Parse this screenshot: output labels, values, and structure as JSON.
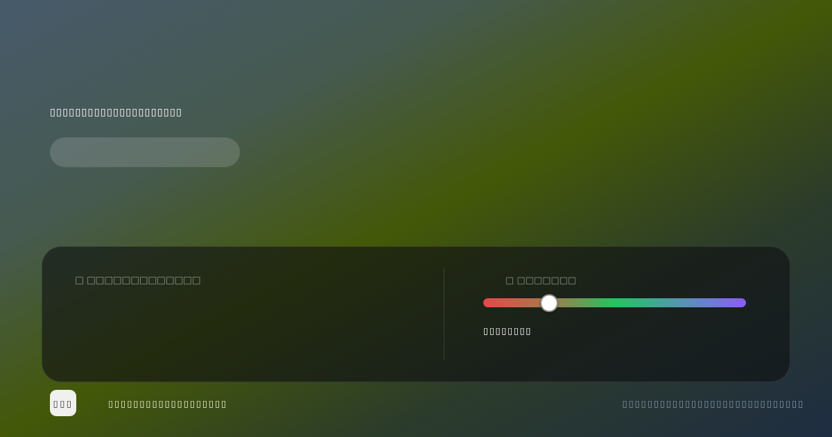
{
  "hero": {
    "heading": "▯▯▯▯▯▯▯▯▯▯▯▯▯▯▯▯▯▯▯▯▯"
  },
  "panel": {
    "left": {
      "label": "□ □□□□□□□□□□□□□"
    },
    "right": {
      "label": "□ □□□□□□□",
      "slider": {
        "level": 0.25
      },
      "value": "▯▯▯▯▯▯▯▯"
    }
  },
  "footer": {
    "logo": "▯▯▯",
    "tagline": "▯▯▯▯▯▯▯▯▯▯▯▯▯▯▯▯▯▯▯",
    "note": "▯▯▯▯▯▯▯▯▯▯▯▯▯▯▯▯▯▯▯▯▯▯▯▯▯▯▯▯▯"
  }
}
